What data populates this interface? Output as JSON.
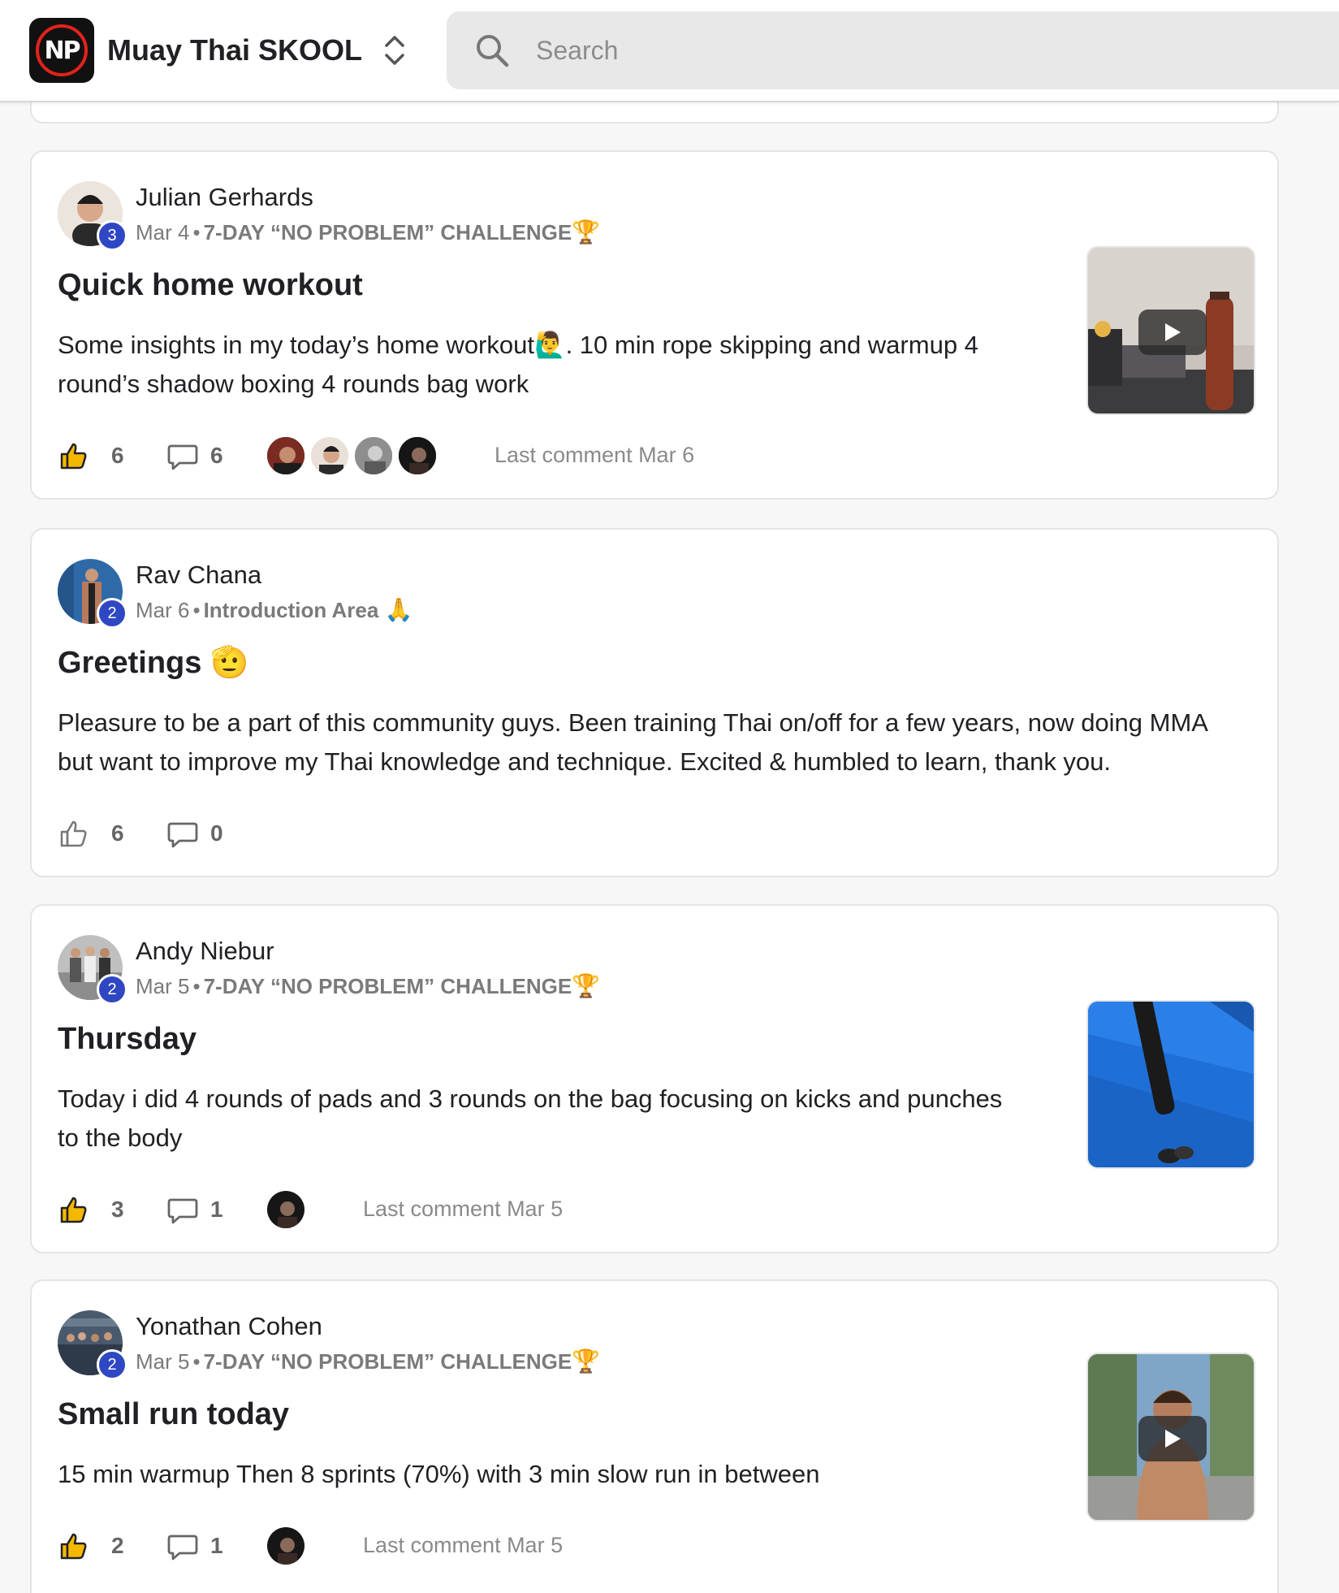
{
  "app": {
    "name": "Muay Thai SKOOL",
    "logo_text": "NP",
    "accent": "#e2231a"
  },
  "search": {
    "placeholder": "Search"
  },
  "icons": {
    "search": "search-icon",
    "switcher": "chevron-up-down-icon",
    "like": "thumbs-up-icon",
    "comment": "comment-bubble-icon",
    "play": "play-icon"
  },
  "colors": {
    "level_badge": "#2f47c3",
    "liked": "#f5b800",
    "muted_text": "#7a7a7a"
  },
  "posts": [
    {
      "author": "Julian Gerhards",
      "level": "3",
      "date": "Mar 4",
      "category": "7-DAY “NO PROBLEM” CHALLENGE",
      "category_emoji": "🏆",
      "title": "Quick home workout",
      "body_line1": "Some insights in my today’s home workout🙋‍♂️. 10 min rope skipping and warmup 4",
      "body_line2": "round’s shadow boxing 4 rounds bag work",
      "likes": "6",
      "liked": true,
      "comments": "6",
      "last_comment": "Last comment Mar 6",
      "has_video": true
    },
    {
      "author": "Rav Chana",
      "level": "2",
      "date": "Mar 6",
      "category": "Introduction Area",
      "category_emoji": "🙏",
      "title": "Greetings",
      "title_emoji": "🫡",
      "body_line1": "Pleasure to be a part of this community guys. Been training Thai on/off for a few years, now doing MMA",
      "body_line2": "but want to improve my Thai knowledge and technique. Excited & humbled to learn, thank you.",
      "likes": "6",
      "liked": false,
      "comments": "0"
    },
    {
      "author": "Andy Niebur",
      "level": "2",
      "date": "Mar 5",
      "category": "7-DAY “NO PROBLEM” CHALLENGE",
      "category_emoji": "🏆",
      "title": "Thursday",
      "body_line1": "Today i did 4 rounds of pads and 3 rounds on the bag focusing on kicks and punches",
      "body_line2": "to the body",
      "likes": "3",
      "liked": true,
      "comments": "1",
      "last_comment": "Last comment Mar 5",
      "has_video": false
    },
    {
      "author": "Yonathan Cohen",
      "level": "2",
      "date": "Mar 5",
      "category": "7-DAY “NO PROBLEM” CHALLENGE",
      "category_emoji": "🏆",
      "title": "Small run today",
      "body_line1": "15 min warmup Then 8 sprints (70%) with 3 min slow run in between",
      "likes": "2",
      "liked": true,
      "comments": "1",
      "last_comment": "Last comment Mar 5",
      "has_video": true
    }
  ],
  "meta_separator": "•"
}
